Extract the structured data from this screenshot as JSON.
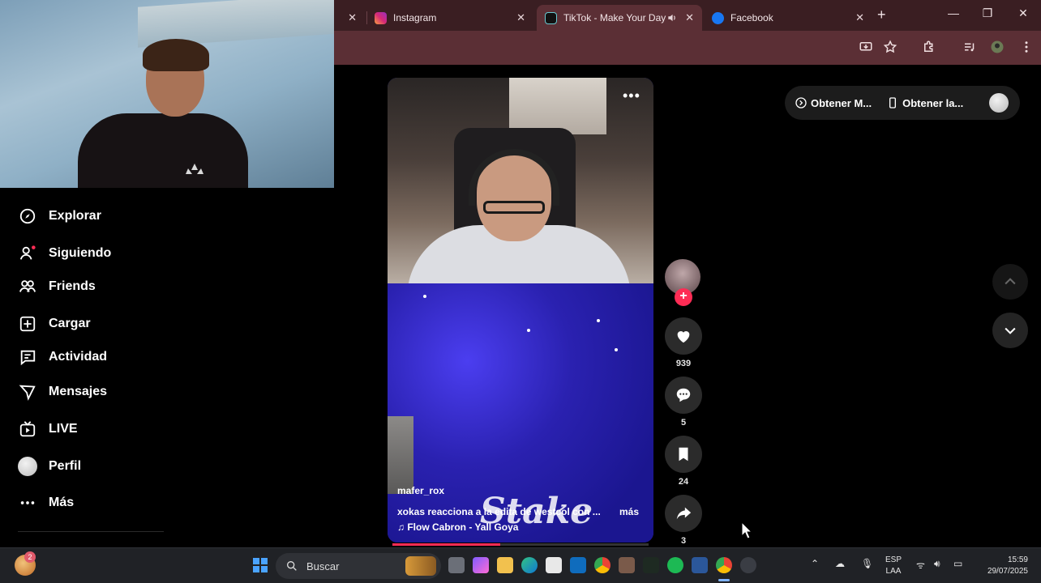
{
  "browser": {
    "tabs": [
      {
        "label": "Instagram",
        "favicon": "instagram-icon"
      },
      {
        "label": "TikTok - Make Your Day",
        "favicon": "tiktok-icon",
        "active": true
      },
      {
        "label": "Facebook",
        "favicon": "facebook-icon"
      }
    ],
    "close_glyph": "✕",
    "newtab_glyph": "+",
    "window_controls": [
      "—",
      "❐",
      "✕"
    ]
  },
  "sidebar": {
    "items": [
      {
        "label": "Explorar",
        "icon": "compass-icon"
      },
      {
        "label": "Siguiendo",
        "icon": "following-icon"
      },
      {
        "label": "Friends",
        "icon": "friends-icon"
      },
      {
        "label": "Cargar",
        "icon": "upload-icon"
      },
      {
        "label": "Actividad",
        "icon": "activity-icon"
      },
      {
        "label": "Mensajes",
        "icon": "messages-icon"
      },
      {
        "label": "LIVE",
        "icon": "live-icon"
      },
      {
        "label": "Perfil",
        "icon": "profile-avatar"
      },
      {
        "label": "Más",
        "icon": "more-icon"
      }
    ]
  },
  "video": {
    "more_glyph": "•••",
    "username": "mafer_rox",
    "description": "xokas reacciona a la edita de westcol con ...",
    "more_label": "más",
    "music": "♫  Flow Cabron - Yall Goya",
    "watermark": "Stake",
    "progress_fraction": 0.42
  },
  "actions": {
    "follow_glyph": "+",
    "like_count": "939",
    "comment_count": "5",
    "save_count": "24",
    "share_count": "3"
  },
  "top_pill": {
    "item1": "Obtener M...",
    "item2": "Obtener la..."
  },
  "taskbar": {
    "weather_badge": "2",
    "search_placeholder": "Buscar",
    "lang_line1": "ESP",
    "lang_line2": "LAA",
    "time": "15:59",
    "date": "29/07/2025"
  },
  "colors": {
    "tab_strip": "#3a1e22",
    "toolbar": "#5b2f35",
    "accent_red": "#fe2c55"
  }
}
